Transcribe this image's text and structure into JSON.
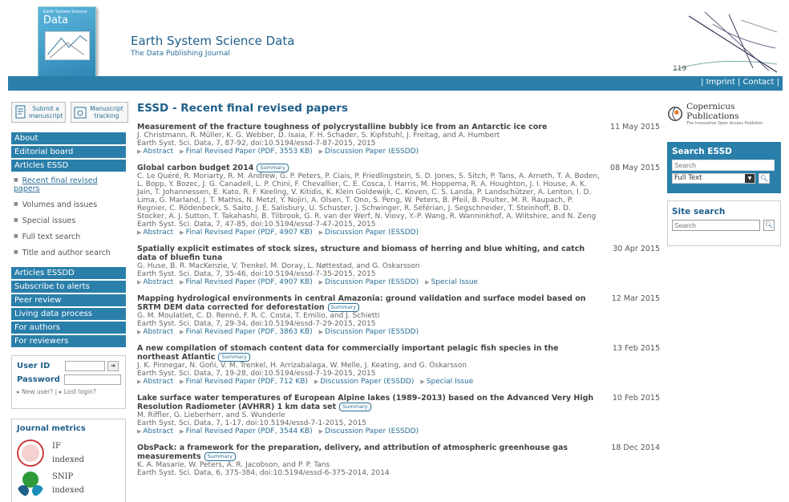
{
  "header": {
    "cover_top": "Earth System Science",
    "cover_title": "Data",
    "title": "Earth System Science Data",
    "subtitle": "The Data Publishing Journal"
  },
  "topbar": {
    "links_text": "| Imprint | Contact |"
  },
  "left": {
    "submit_label": "Submit a manuscript",
    "tracking_label": "Manuscript tracking",
    "nav_top": [
      "About",
      "Editorial board",
      "Articles ESSD"
    ],
    "subnav": [
      "Recent final revised papers",
      "Volumes and issues",
      "Special issues",
      "Full text search",
      "Title and author search"
    ],
    "nav_bottom": [
      "Articles ESSDD",
      "Subscribe to alerts",
      "Peer review",
      "Living data process",
      "For authors",
      "For reviewers"
    ],
    "login": {
      "user_label": "User ID",
      "password_label": "Password",
      "new_user": "New user?",
      "lost_login": "Lost login?"
    },
    "metrics": {
      "title": "Journal metrics",
      "items": [
        {
          "name": "IF",
          "status": "indexed"
        },
        {
          "name": "SNIP",
          "status": "indexed"
        }
      ]
    }
  },
  "main": {
    "title": "ESSD - Recent final revised papers",
    "papers": [
      {
        "title": "Measurement of the fracture toughness of polycrystalline bubbly ice from an Antarctic ice core",
        "summary": "",
        "date": "11 May 2015",
        "authors": "J. Christmann, R. Müller, K. G. Webber, D. Isaia, F. H. Schader, S. Kipfstuhl, J. Freitag, and A. Humbert",
        "citation": "Earth Syst. Sci. Data, 7, 87-92, doi:10.5194/essd-7-87-2015, 2015",
        "links": [
          "Abstract",
          "Final Revised Paper (PDF, 3553 KB)",
          "Discussion Paper (ESSDD)"
        ]
      },
      {
        "title": "Global carbon budget 2014",
        "summary": "Summary",
        "date": "08 May 2015",
        "authors": "C. Le Quéré, R. Moriarty, R. M. Andrew, G. P. Peters, P. Ciais, P. Friedlingstein, S. D. Jones, S. Sitch, P. Tans, A. Arneth, T. A. Boden, L. Bopp, Y. Bozec, J. G. Canadell, L. P. Chini, F. Chevallier, C. E. Cosca, I. Harris, M. Hoppema, R. A. Houghton, J. I. House, A. K. Jain, T. Johannessen, E. Kato, R. F. Keeling, V. Kitidis, K. Klein Goldewijk, C. Koven, C. S. Landa, P. Landschützer, A. Lenton, I. D. Lima, G. Marland, J. T. Mathis, N. Metzl, Y. Nojiri, A. Olsen, T. Ono, S. Peng, W. Peters, B. Pfeil, B. Poulter, M. R. Raupach, P. Regnier, C. Rödenbeck, S. Saito, J. E. Salisbury, U. Schuster, J. Schwinger, R. Séférian, J. Segschneider, T. Steinhoff, B. D. Stocker, A. J. Sutton, T. Takahashi, B. Tilbrook, G. R. van der Werf, N. Viovy, Y.-P. Wang, R. Wanninkhof, A. Wiltshire, and N. Zeng",
        "citation": "Earth Syst. Sci. Data, 7, 47-85, doi:10.5194/essd-7-47-2015, 2015",
        "links": [
          "Abstract",
          "Final Revised Paper (PDF, 4907 KB)",
          "Discussion Paper (ESSDD)"
        ]
      },
      {
        "title": "Spatially explicit estimates of stock sizes, structure and biomass of herring and blue whiting, and catch data of bluefin tuna",
        "summary": "",
        "date": "30 Apr 2015",
        "authors": "G. Huse, B. R. MacKenzie, V. Trenkel, M. Doray, L. Nøttestad, and G. Oskarsson",
        "citation": "Earth Syst. Sci. Data, 7, 35-46, doi:10.5194/essd-7-35-2015, 2015",
        "links": [
          "Abstract",
          "Final Revised Paper (PDF, 4907 KB)",
          "Discussion Paper (ESSDD)",
          "Special Issue"
        ]
      },
      {
        "title": "Mapping hydrological environments in central Amazonia: ground validation and surface model based on SRTM DEM data corrected for deforestation",
        "summary": "Summary",
        "date": "12 Mar 2015",
        "authors": "G. M. Moulatlet, C. D. Rennó, F. R. C. Costa, T. Emilio, and J. Schietti",
        "citation": "Earth Syst. Sci. Data, 7, 29-34, doi:10.5194/essd-7-29-2015, 2015",
        "links": [
          "Abstract",
          "Final Revised Paper (PDF, 3863 KB)",
          "Discussion Paper (ESSDD)"
        ]
      },
      {
        "title": "A new compilation of stomach content data for commercially important pelagic fish species in the northeast Atlantic",
        "summary": "Summary",
        "date": "13 Feb 2015",
        "authors": "J. K. Pinnegar, N. Goñi, V. M. Trenkel, H. Arrizabalaga, W. Melle, J. Keating, and G. Óskarsson",
        "citation": "Earth Syst. Sci. Data, 7, 19-28, doi:10.5194/essd-7-19-2015, 2015",
        "links": [
          "Abstract",
          "Final Revised Paper (PDF, 712 KB)",
          "Discussion Paper (ESSDD)",
          "Special Issue"
        ]
      },
      {
        "title": "Lake surface water temperatures of European Alpine lakes (1989–2013) based on the Advanced Very High Resolution Radiometer (AVHRR) 1 km data set",
        "summary": "Summary",
        "date": "10 Feb 2015",
        "authors": "M. Riffler, G. Lieberherr, and S. Wunderle",
        "citation": "Earth Syst. Sci. Data, 7, 1-17, doi:10.5194/essd-7-1-2015, 2015",
        "links": [
          "Abstract",
          "Final Revised Paper (PDF, 3544 KB)",
          "Discussion Paper (ESSDD)"
        ]
      },
      {
        "title": "ObsPack: a framework for the preparation, delivery, and attribution of atmospheric greenhouse gas measurements",
        "summary": "Summary",
        "date": "18 Dec 2014",
        "authors": "K. A. Masarie, W. Peters, A. R. Jacobson, and P. P. Tans",
        "citation": "Earth Syst. Sci. Data, 6, 375-384, doi:10.5194/essd-6-375-2014, 2014",
        "links": []
      }
    ]
  },
  "right": {
    "publisher_name": "Copernicus Publications",
    "publisher_tagline": "The Innovative Open Access Publisher",
    "search_title": "Search ESSD",
    "search_placeholder": "Search",
    "search_select": "Full Text",
    "site_search_title": "Site search",
    "site_search_placeholder": "Search"
  },
  "colors": {
    "brand_blue": "#2a7faa",
    "title_blue": "#1f5f8b"
  }
}
